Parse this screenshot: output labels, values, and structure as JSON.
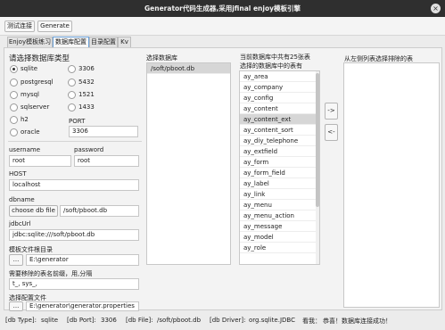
{
  "window": {
    "title": "Generator代码生成器,采用jfinal enjoy模板引擎"
  },
  "toolbar": {
    "test_conn": "测试连接",
    "generate": "Generate"
  },
  "tabs": [
    "Enjoy模板练习",
    "数据库配置",
    "目录配置",
    "Kv"
  ],
  "db": {
    "heading": "请选择数据库类型",
    "types": [
      {
        "name": "sqlite",
        "port": "3306",
        "checked": true
      },
      {
        "name": "postgresql",
        "port": "5432",
        "checked": false
      },
      {
        "name": "mysql",
        "port": "1521",
        "checked": false
      },
      {
        "name": "sqlserver",
        "port": "1433",
        "checked": false
      },
      {
        "name": "h2",
        "port": "",
        "checked": false
      },
      {
        "name": "oracle",
        "port": "",
        "checked": false
      }
    ],
    "port_label": "PORT",
    "port_value": "3306",
    "username_label": "username",
    "username_value": "root",
    "password_label": "password",
    "password_value": "root",
    "host_label": "HOST",
    "host_value": "localhost",
    "dbname_label": "dbname",
    "choose_btn": "choose db file",
    "dbname_value": "/soft/pboot.db",
    "jdbc_label": "jdbcUrl",
    "jdbc_value": "jdbc:sqlite:///soft/pboot.db",
    "template_label": "模板文件根目录",
    "template_btn": "...",
    "template_value": "E:\\generator",
    "prefix_label": "需要移除的表名前缀，用,分隔",
    "prefix_value": "t_, sys_,",
    "config_label": "选择配置文件",
    "config_btn": "...",
    "config_value": "E:\\generator\\generator.properties"
  },
  "dbfiles": {
    "label": "选择数据库",
    "items": [
      "/soft/pboot.db"
    ]
  },
  "tables": {
    "count_label": "当前数据库中共有25张表",
    "sub_label": "选择的数据库中的表有",
    "items": [
      "ay_area",
      "ay_company",
      "ay_config",
      "ay_content",
      "ay_content_ext",
      "ay_content_sort",
      "ay_diy_telephone",
      "ay_extfield",
      "ay_form",
      "ay_form_field",
      "ay_label",
      "ay_link",
      "ay_menu",
      "ay_menu_action",
      "ay_message",
      "ay_model",
      "ay_role"
    ],
    "selected_index": 4
  },
  "move": {
    "right": "->",
    "left": "<-"
  },
  "excluded": {
    "label": "从左侧列表选择排除的表"
  },
  "status": {
    "db_type_label": "[db Type]:",
    "db_type_value": "sqlite",
    "db_port_label": "[db Port]:",
    "db_port_value": "3306",
    "db_file_label": "[db File]:",
    "db_file_value": "/soft/pboot.db",
    "db_driver_label": "[db Driver]:",
    "db_driver_value": "org.sqlite.JDBC",
    "look_label": "看我：",
    "message": "恭喜！数据库连接成功！"
  }
}
